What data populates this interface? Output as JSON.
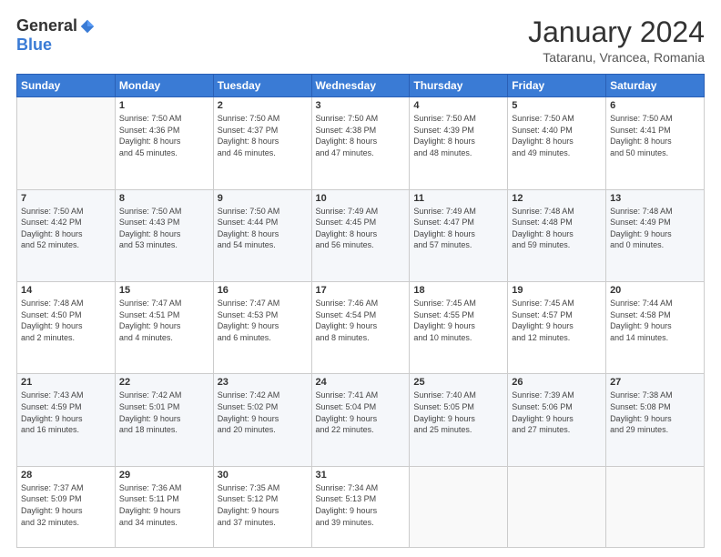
{
  "header": {
    "logo": {
      "general": "General",
      "blue": "Blue"
    },
    "title": "January 2024",
    "location": "Tataranu, Vrancea, Romania"
  },
  "weekdays": [
    "Sunday",
    "Monday",
    "Tuesday",
    "Wednesday",
    "Thursday",
    "Friday",
    "Saturday"
  ],
  "weeks": [
    [
      {
        "day": "",
        "info": ""
      },
      {
        "day": "1",
        "info": "Sunrise: 7:50 AM\nSunset: 4:36 PM\nDaylight: 8 hours\nand 45 minutes."
      },
      {
        "day": "2",
        "info": "Sunrise: 7:50 AM\nSunset: 4:37 PM\nDaylight: 8 hours\nand 46 minutes."
      },
      {
        "day": "3",
        "info": "Sunrise: 7:50 AM\nSunset: 4:38 PM\nDaylight: 8 hours\nand 47 minutes."
      },
      {
        "day": "4",
        "info": "Sunrise: 7:50 AM\nSunset: 4:39 PM\nDaylight: 8 hours\nand 48 minutes."
      },
      {
        "day": "5",
        "info": "Sunrise: 7:50 AM\nSunset: 4:40 PM\nDaylight: 8 hours\nand 49 minutes."
      },
      {
        "day": "6",
        "info": "Sunrise: 7:50 AM\nSunset: 4:41 PM\nDaylight: 8 hours\nand 50 minutes."
      }
    ],
    [
      {
        "day": "7",
        "info": "Sunrise: 7:50 AM\nSunset: 4:42 PM\nDaylight: 8 hours\nand 52 minutes."
      },
      {
        "day": "8",
        "info": "Sunrise: 7:50 AM\nSunset: 4:43 PM\nDaylight: 8 hours\nand 53 minutes."
      },
      {
        "day": "9",
        "info": "Sunrise: 7:50 AM\nSunset: 4:44 PM\nDaylight: 8 hours\nand 54 minutes."
      },
      {
        "day": "10",
        "info": "Sunrise: 7:49 AM\nSunset: 4:45 PM\nDaylight: 8 hours\nand 56 minutes."
      },
      {
        "day": "11",
        "info": "Sunrise: 7:49 AM\nSunset: 4:47 PM\nDaylight: 8 hours\nand 57 minutes."
      },
      {
        "day": "12",
        "info": "Sunrise: 7:48 AM\nSunset: 4:48 PM\nDaylight: 8 hours\nand 59 minutes."
      },
      {
        "day": "13",
        "info": "Sunrise: 7:48 AM\nSunset: 4:49 PM\nDaylight: 9 hours\nand 0 minutes."
      }
    ],
    [
      {
        "day": "14",
        "info": "Sunrise: 7:48 AM\nSunset: 4:50 PM\nDaylight: 9 hours\nand 2 minutes."
      },
      {
        "day": "15",
        "info": "Sunrise: 7:47 AM\nSunset: 4:51 PM\nDaylight: 9 hours\nand 4 minutes."
      },
      {
        "day": "16",
        "info": "Sunrise: 7:47 AM\nSunset: 4:53 PM\nDaylight: 9 hours\nand 6 minutes."
      },
      {
        "day": "17",
        "info": "Sunrise: 7:46 AM\nSunset: 4:54 PM\nDaylight: 9 hours\nand 8 minutes."
      },
      {
        "day": "18",
        "info": "Sunrise: 7:45 AM\nSunset: 4:55 PM\nDaylight: 9 hours\nand 10 minutes."
      },
      {
        "day": "19",
        "info": "Sunrise: 7:45 AM\nSunset: 4:57 PM\nDaylight: 9 hours\nand 12 minutes."
      },
      {
        "day": "20",
        "info": "Sunrise: 7:44 AM\nSunset: 4:58 PM\nDaylight: 9 hours\nand 14 minutes."
      }
    ],
    [
      {
        "day": "21",
        "info": "Sunrise: 7:43 AM\nSunset: 4:59 PM\nDaylight: 9 hours\nand 16 minutes."
      },
      {
        "day": "22",
        "info": "Sunrise: 7:42 AM\nSunset: 5:01 PM\nDaylight: 9 hours\nand 18 minutes."
      },
      {
        "day": "23",
        "info": "Sunrise: 7:42 AM\nSunset: 5:02 PM\nDaylight: 9 hours\nand 20 minutes."
      },
      {
        "day": "24",
        "info": "Sunrise: 7:41 AM\nSunset: 5:04 PM\nDaylight: 9 hours\nand 22 minutes."
      },
      {
        "day": "25",
        "info": "Sunrise: 7:40 AM\nSunset: 5:05 PM\nDaylight: 9 hours\nand 25 minutes."
      },
      {
        "day": "26",
        "info": "Sunrise: 7:39 AM\nSunset: 5:06 PM\nDaylight: 9 hours\nand 27 minutes."
      },
      {
        "day": "27",
        "info": "Sunrise: 7:38 AM\nSunset: 5:08 PM\nDaylight: 9 hours\nand 29 minutes."
      }
    ],
    [
      {
        "day": "28",
        "info": "Sunrise: 7:37 AM\nSunset: 5:09 PM\nDaylight: 9 hours\nand 32 minutes."
      },
      {
        "day": "29",
        "info": "Sunrise: 7:36 AM\nSunset: 5:11 PM\nDaylight: 9 hours\nand 34 minutes."
      },
      {
        "day": "30",
        "info": "Sunrise: 7:35 AM\nSunset: 5:12 PM\nDaylight: 9 hours\nand 37 minutes."
      },
      {
        "day": "31",
        "info": "Sunrise: 7:34 AM\nSunset: 5:13 PM\nDaylight: 9 hours\nand 39 minutes."
      },
      {
        "day": "",
        "info": ""
      },
      {
        "day": "",
        "info": ""
      },
      {
        "day": "",
        "info": ""
      }
    ]
  ]
}
